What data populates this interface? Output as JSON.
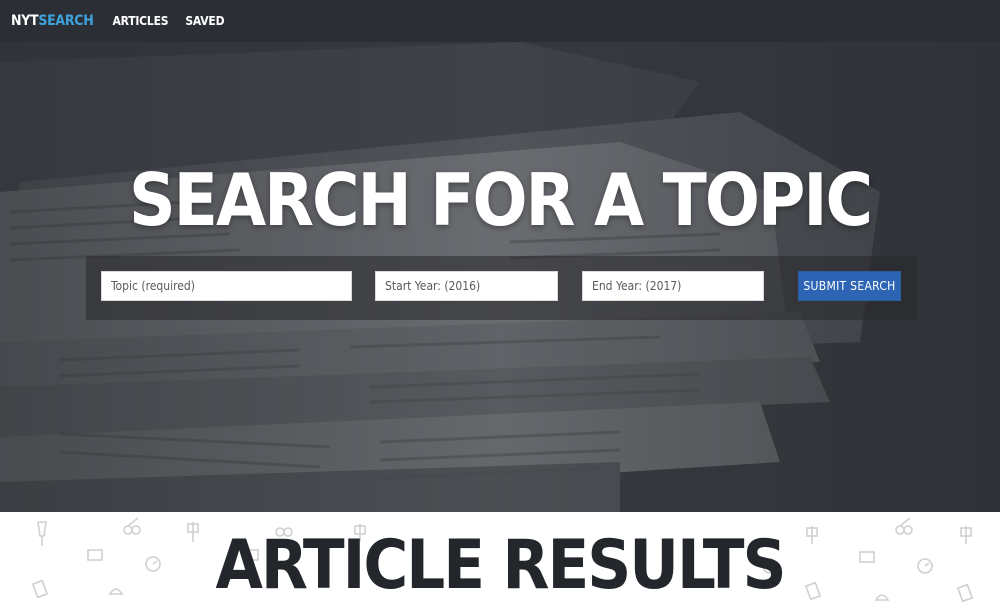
{
  "navbar": {
    "brand_part1": "NYT",
    "brand_part2": "SEARCH",
    "links": [
      "ARTICLES",
      "SAVED"
    ]
  },
  "hero": {
    "title": "SEARCH FOR A TOPIC",
    "topic_placeholder": "Topic (required)",
    "start_year_placeholder": "Start Year: (2016)",
    "end_year_placeholder": "End Year: (2017)",
    "submit_label": "SUBMIT SEARCH"
  },
  "results": {
    "title": "ARTICLE RESULTS"
  },
  "colors": {
    "navbar_bg": "#2b2f35",
    "brand_accent": "#3fa3dd",
    "submit_bg": "#2d65b4",
    "hero_overlay": "#3c3f44",
    "results_title": "#23262b"
  },
  "icons": {
    "background_image": "newspaper-stack-photo",
    "results_pattern": [
      "lamp-icon",
      "clock-icon",
      "pushpin-icon",
      "coffee-cup-icon",
      "notepad-icon",
      "scissors-icon"
    ]
  }
}
